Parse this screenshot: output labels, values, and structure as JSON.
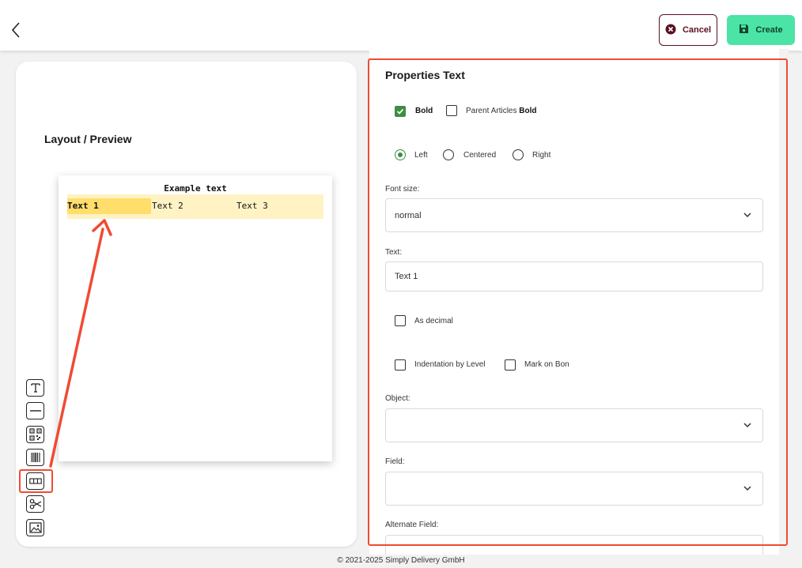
{
  "header": {
    "back_icon": "chevron-left-icon",
    "cancel_label": "Cancel",
    "cancel_icon": "cancel-circle-icon",
    "create_label": "Create",
    "create_icon": "floppy-disk-icon",
    "cancel_color": "#5a1020",
    "create_color": "#4be3a6"
  },
  "left": {
    "title": "Layout / Preview",
    "preview": {
      "title": "Example text",
      "cells": [
        "Text 1",
        "Text 2",
        "Text 3"
      ]
    },
    "tools": [
      {
        "name": "text-tool-icon",
        "glyph": "T"
      },
      {
        "name": "line-tool-icon"
      },
      {
        "name": "qr-code-tool-icon"
      },
      {
        "name": "barcode-tool-icon"
      },
      {
        "name": "columns-tool-icon",
        "selected": true
      },
      {
        "name": "scissors-tool-icon",
        "glyph": "✂"
      },
      {
        "name": "image-tool-icon"
      }
    ],
    "highlight_color": "#f04b33"
  },
  "properties": {
    "title": "Properties Text",
    "bold_label": "Bold",
    "bold_checked": true,
    "parent_bold_label_prefix": "Parent Articles ",
    "parent_bold_label_bold": "Bold",
    "parent_bold_checked": false,
    "align_left_label": "Left",
    "align_centered_label": "Centered",
    "align_right_label": "Right",
    "align_selected": "Left",
    "font_size_label": "Font size:",
    "font_size_value": "normal",
    "text_label": "Text:",
    "text_value": "Text 1",
    "as_decimal_label": "As decimal",
    "as_decimal_checked": false,
    "indentation_label": "Indentation by Level",
    "indentation_checked": false,
    "mark_on_bon_label": "Mark on Bon",
    "mark_on_bon_checked": false,
    "object_label": "Object:",
    "object_value": "",
    "field_label": "Field:",
    "field_value": "",
    "alternate_field_label": "Alternate Field:",
    "accent_color": "#3d8d43"
  },
  "footer": {
    "text": "© 2021-2025 Simply Delivery GmbH"
  }
}
